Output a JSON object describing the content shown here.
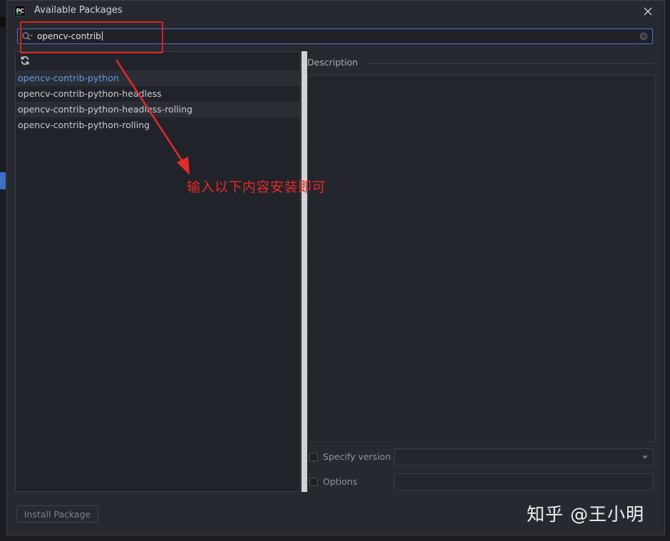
{
  "window": {
    "title": "Available Packages",
    "app_logo": "PC"
  },
  "search": {
    "value": "opencv-contrib"
  },
  "packages": [
    {
      "name": "opencv-contrib-python",
      "selected": true
    },
    {
      "name": "opencv-contrib-python-headless",
      "selected": false
    },
    {
      "name": "opencv-contrib-python-headless-rolling",
      "selected": false
    },
    {
      "name": "opencv-contrib-python-rolling",
      "selected": false
    }
  ],
  "description": {
    "label": "Description"
  },
  "options": {
    "specify_version_label": "Specify version",
    "options_label": "Options"
  },
  "actions": {
    "install_label": "Install Package"
  },
  "annotation": {
    "text": "输入以下内容安装即可",
    "color": "#e62a2a"
  },
  "watermark": {
    "text": "知乎 @王小明"
  },
  "colors": {
    "accent": "#4a78c2",
    "selected_text": "#5f9be6",
    "background": "#262930"
  }
}
